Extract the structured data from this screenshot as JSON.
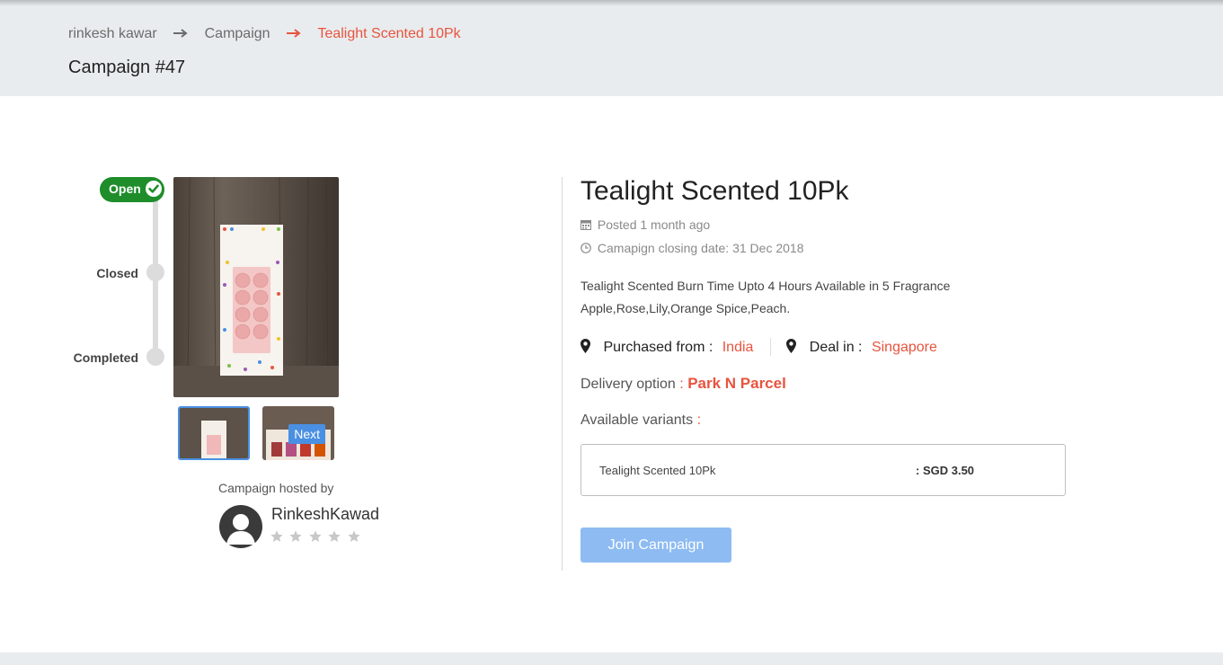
{
  "breadcrumb": {
    "items": [
      "rinkesh kawar",
      "Campaign",
      "Tealight Scented 10Pk"
    ]
  },
  "page": {
    "title": "Campaign #47"
  },
  "status": {
    "steps": [
      "Open",
      "Closed",
      "Completed"
    ],
    "current": "Open",
    "colors": {
      "active": "#1e8d2a",
      "inactive": "#dcdcdc"
    }
  },
  "gallery": {
    "next_label": "Next",
    "product_image_icon": "candle-box-image"
  },
  "host": {
    "label": "Campaign hosted by",
    "name": "RinkeshKawad",
    "rating": 0,
    "max_rating": 5
  },
  "product": {
    "title": "Tealight Scented 10Pk",
    "posted": "Posted 1 month ago",
    "closing": "Camapign closing date: 31 Dec 2018",
    "description": "Tealight Scented Burn Time Upto 4 Hours Available in 5 Fragrance Apple,Rose,Lily,Orange Spice,Peach.",
    "purchased_from_label": "Purchased from :",
    "purchased_from": "India",
    "deal_in_label": "Deal in :",
    "deal_in": "Singapore",
    "delivery_label": "Delivery option",
    "delivery_sep": ":",
    "delivery_value": "Park N Parcel",
    "variants_label": "Available variants",
    "variants_sep": ":",
    "variants": [
      {
        "name": "Tealight Scented 10Pk",
        "price": ": SGD 3.50"
      }
    ]
  },
  "actions": {
    "join_label": "Join Campaign"
  },
  "colors": {
    "accent": "#e8543f",
    "primary": "#4a90e2",
    "button_disabled": "#8dbbf2"
  }
}
